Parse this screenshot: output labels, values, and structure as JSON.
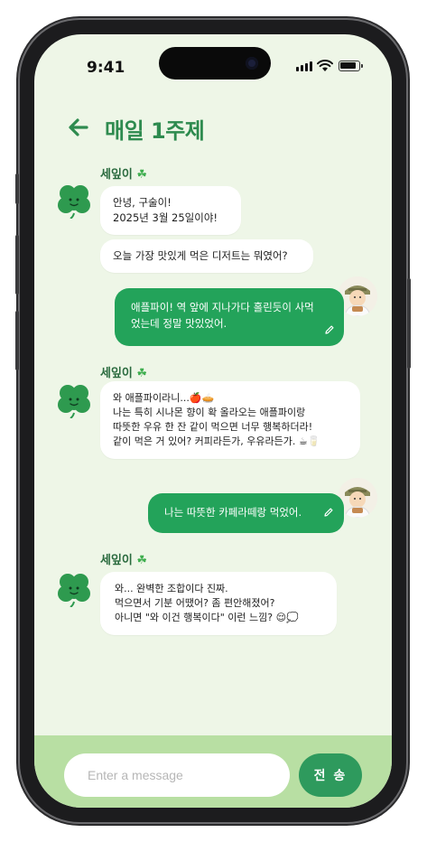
{
  "status": {
    "time": "9:41"
  },
  "header": {
    "title": "매일 1주제"
  },
  "bot": {
    "name": "세잎이",
    "clover": "☘"
  },
  "messages": {
    "m1": "안녕, 구술이!\n2025년 3월 25일이야!",
    "m2": "오늘 가장 맛있게 먹은 디저트는 뭐였어?",
    "m3": "애플파이! 역 앞에 지나가다 홀린듯이 사먹\n었는데 정말 맛있었어.",
    "m4": "와 애플파이라니...🍎🥧\n나는 특히 시나몬 향이 확 올라오는 애플파이랑\n따뜻한 우유 한 잔 같이 먹으면 너무 행복하더라!\n같이 먹은 거 있어? 커피라든가, 우유라든가. ☕🥛",
    "m5": "나는 따뜻한 카페라떼랑 먹었어.",
    "m6": "와... 완벽한 조합이다 진짜.\n먹으면서 기분 어땠어? 좀 편안해졌어?\n아니면 \"와 이건 행복이다\" 이런 느낌? 😌💭"
  },
  "composer": {
    "placeholder": "Enter a message",
    "send_label": "전 송"
  },
  "colors": {
    "accent": "#23a35a",
    "background": "#eef6e7",
    "composer": "#b8dfa3",
    "title": "#2e8b4f"
  },
  "icons": [
    "back-arrow-icon",
    "pencil-icon",
    "clover-avatar-icon",
    "user-avatar-icon",
    "wifi-icon",
    "signal-icon",
    "battery-icon"
  ]
}
